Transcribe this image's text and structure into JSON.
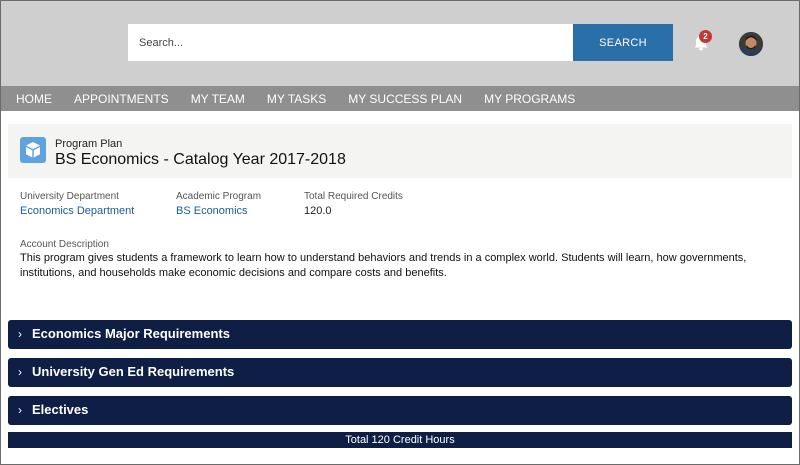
{
  "header": {
    "search_placeholder": "Search...",
    "search_button": "SEARCH",
    "notification_count": "2",
    "colors": {
      "topbar": "#cfcfcf",
      "search_button": "#2b6fa8",
      "badge": "#c23934"
    }
  },
  "nav": {
    "items": [
      "HOME",
      "APPOINTMENTS",
      "MY TEAM",
      "MY TASKS",
      "MY SUCCESS PLAN",
      "MY PROGRAMS"
    ]
  },
  "record": {
    "object_label": "Program Plan",
    "title": "BS Economics - Catalog Year 2017-2018",
    "icon": "cube-icon",
    "fields": [
      {
        "label": "University Department",
        "value": "Economics Department",
        "is_link": true
      },
      {
        "label": "Academic Program",
        "value": "BS Economics",
        "is_link": true
      },
      {
        "label": "Total Required Credits",
        "value": "120.0",
        "is_link": false
      }
    ],
    "description_label": "Account Description",
    "description": "This program gives students a framework to learn how to understand behaviors and trends in a complex world. Students will learn, how governments, institutions, and households make economic decisions and compare costs and benefits."
  },
  "sections": [
    "Economics Major Requirements",
    "University Gen Ed Requirements",
    "Electives"
  ],
  "total": "Total 120 Credit Hours",
  "colors": {
    "section": "#0f1e45",
    "link": "#1a5c9a",
    "icon": "#5ea2e0"
  }
}
